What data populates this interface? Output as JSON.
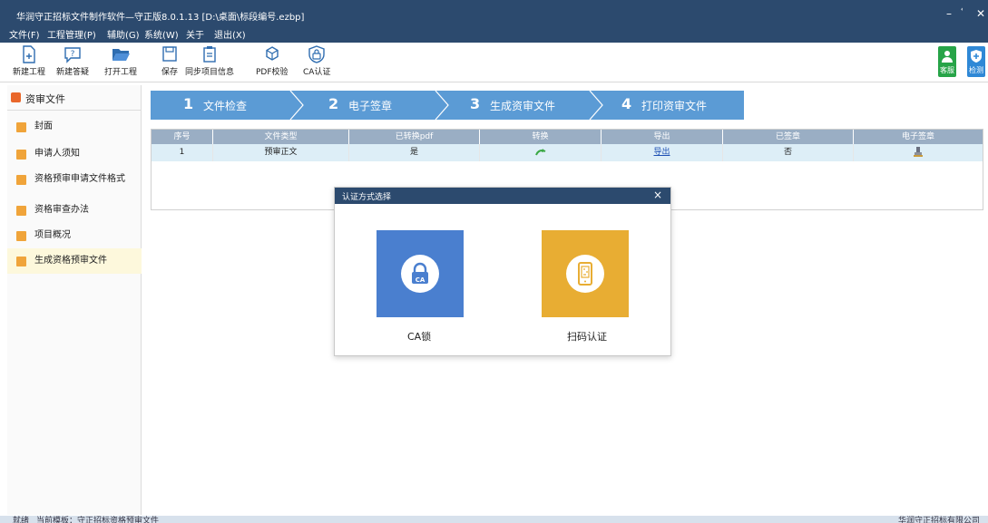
{
  "window": {
    "title": "华润守正招标文件制作软件—守正版8.0.1.13    [D:\\桌面\\标段编号.ezbp]",
    "minimize": "–",
    "restore": "ꜗ",
    "close": "✕"
  },
  "menu": [
    "文件(F)",
    "工程管理(P)",
    "辅助(G)",
    "系统(W)",
    "关于",
    "退出(X)"
  ],
  "toolbar": {
    "new_project": "新建工程",
    "new_qa": "新建答疑",
    "open_project": "打开工程",
    "save": "保存",
    "sync_info": "同步项目信息",
    "pdf_check": "PDF校验",
    "ca_auth": "CA认证",
    "support": "客服",
    "detect": "检测"
  },
  "sidebar": {
    "header": "资审文件",
    "items": [
      "封面",
      "申请人须知",
      "资格预审申请文件格式",
      "资格审查办法",
      "项目概况",
      "生成资格预审文件"
    ]
  },
  "steps": [
    {
      "num": "1",
      "label": "文件检查"
    },
    {
      "num": "2",
      "label": "电子签章"
    },
    {
      "num": "3",
      "label": "生成资审文件"
    },
    {
      "num": "4",
      "label": "打印资审文件"
    }
  ],
  "table": {
    "headers": [
      "序号",
      "文件类型",
      "已转换pdf",
      "转换",
      "导出",
      "已签章",
      "电子签章"
    ],
    "rows": [
      {
        "no": "1",
        "type": "预审正文",
        "converted": "是",
        "export": "导出",
        "signed": "否"
      }
    ]
  },
  "dialog": {
    "title": "认证方式选择",
    "close": "×",
    "options": [
      {
        "label": "CA锁",
        "color": "#4a7fcf",
        "icon": "ca-lock-icon",
        "icon_text": "CA"
      },
      {
        "label": "扫码认证",
        "color": "#e8ad33",
        "icon": "qr-phone-icon"
      }
    ]
  },
  "status": {
    "left": "就绪",
    "middle": "当前模板：守正招标资格预审文件",
    "right": "华润守正招标有限公司"
  },
  "colors": {
    "titlebar": "#2c4a6e",
    "steps": "#5b9bd5",
    "table_header": "#9aaec4",
    "row": "#ddeef7",
    "accent_green": "#27a448",
    "accent_blue": "#2f88d6"
  }
}
